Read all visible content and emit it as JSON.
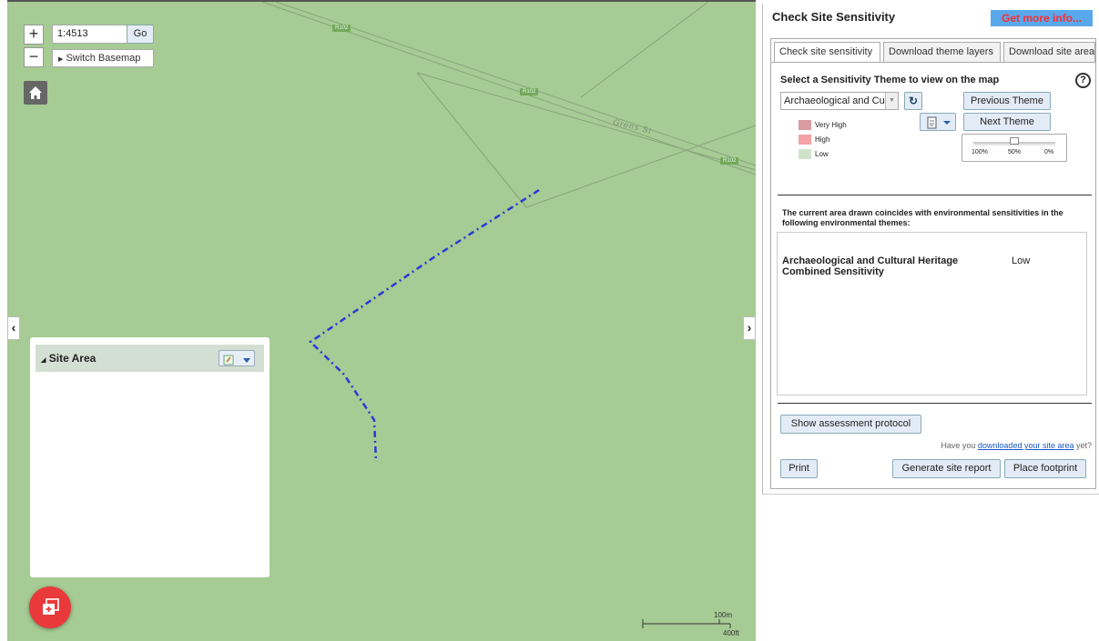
{
  "map": {
    "scale_value": "1:4513",
    "go_label": "Go",
    "basemap_label": "Switch Basemap",
    "road_labels": [
      "R102",
      "R102",
      "R102"
    ],
    "street_name": "Grens St",
    "site_area": {
      "title": "Site Area"
    },
    "scalebar": {
      "metric": "100m",
      "imperial": "400ft"
    }
  },
  "panel": {
    "title": "Check Site Sensitivity",
    "more_info_label": "Get more info...",
    "tabs": [
      {
        "label": "Check site sensitivity"
      },
      {
        "label": "Download theme layers"
      },
      {
        "label": "Download site area"
      }
    ],
    "theme_heading": "Select a Sensitivity Theme to view on the map",
    "theme_selected": "Archaeological and Cultural Heritage Combined Sensitivity",
    "previous_label": "Previous Theme",
    "next_label": "Next Theme",
    "legend": [
      {
        "label": "Very High",
        "color": "#d99aa0"
      },
      {
        "label": "High",
        "color": "#f4a2a6"
      },
      {
        "label": "Low",
        "color": "#cfe3cb"
      }
    ],
    "opacity": {
      "ticks": [
        "100%",
        "50%",
        "0%"
      ],
      "level": 0.5
    },
    "coincide_text": "The current area drawn coincides with environmental sensitivities in the following environmental themes:",
    "results": [
      {
        "theme": "Archaeological and Cultural Heritage Combined Sensitivity",
        "level": "Low"
      }
    ],
    "protocol_label": "Show assessment protocol",
    "download_prefix": "Have you ",
    "download_link": "downloaded your site area",
    "download_suffix": " yet?",
    "print_label": "Print",
    "report_label": "Generate site report",
    "footprint_label": "Place footprint"
  }
}
